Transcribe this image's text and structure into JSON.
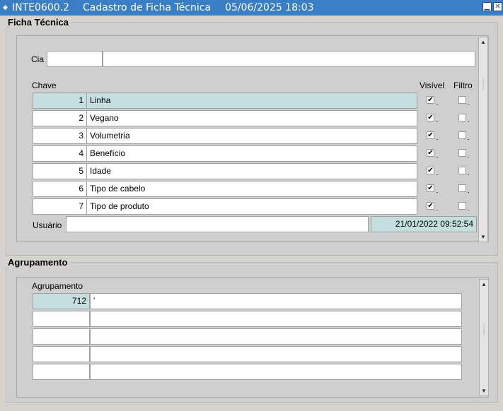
{
  "window": {
    "form_id": "INTE0600.2",
    "form_title": "Cadastro de Ficha Técnica",
    "datetime": "05/06/2025 18:03",
    "minimize_glyph": "▁",
    "close_glyph": "✕"
  },
  "ficha": {
    "frame_label": "Ficha Técnica",
    "cia_label": "Cia",
    "cia_code": "",
    "cia_name": "",
    "headers": {
      "chave": "Chave",
      "visivel": "Visível",
      "filtro": "Filtro"
    },
    "rows": [
      {
        "num": "1",
        "desc": "Linha",
        "visivel": true,
        "filtro": false
      },
      {
        "num": "2",
        "desc": "Vegano",
        "visivel": true,
        "filtro": false
      },
      {
        "num": "3",
        "desc": "Volumetria",
        "visivel": true,
        "filtro": false
      },
      {
        "num": "4",
        "desc": "Benefício",
        "visivel": true,
        "filtro": false
      },
      {
        "num": "5",
        "desc": "Idade",
        "visivel": true,
        "filtro": false
      },
      {
        "num": "6",
        "desc": "Tipo de cabelo",
        "visivel": true,
        "filtro": false
      },
      {
        "num": "7",
        "desc": "Tipo de produto",
        "visivel": true,
        "filtro": false
      }
    ],
    "usuario_label": "Usuário",
    "usuario_value": "",
    "usuario_date": "21/01/2022 09:52:54"
  },
  "agrup": {
    "frame_label": "Agrupamento",
    "col_label": "Agrupamento",
    "rows": [
      {
        "code": "712",
        "desc": "'"
      },
      {
        "code": "",
        "desc": ""
      },
      {
        "code": "",
        "desc": ""
      },
      {
        "code": "",
        "desc": ""
      },
      {
        "code": "",
        "desc": ""
      }
    ]
  },
  "icons": {
    "app": "form-icon",
    "scroll_up": "triangle-up-icon",
    "scroll_down": "triangle-down-icon",
    "grip": "grip-dots-icon",
    "check": "checkmark-icon"
  },
  "colors": {
    "titlebar": "#3a7fc5",
    "current_record": "#c5dfe0",
    "background": "#d6d3ce"
  }
}
